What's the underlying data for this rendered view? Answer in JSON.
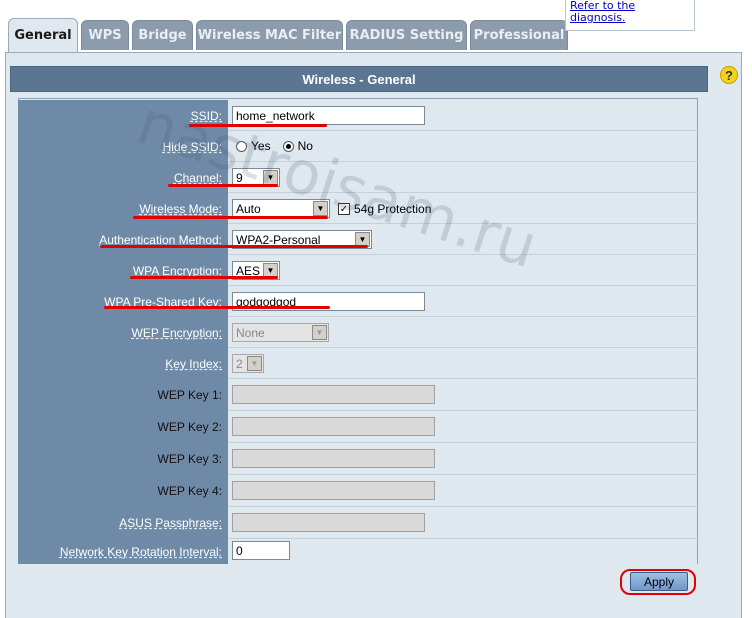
{
  "tabs": [
    {
      "label": "General",
      "active": true
    },
    {
      "label": "WPS",
      "active": false
    },
    {
      "label": "Bridge",
      "active": false
    },
    {
      "label": "Wireless MAC Filter",
      "active": false
    },
    {
      "label": "RADIUS Setting",
      "active": false
    },
    {
      "label": "Professional",
      "active": false
    }
  ],
  "diagnosis_link": {
    "line1": "Refer to the",
    "line2": "diagnosis."
  },
  "panel": {
    "title": "Wireless - General",
    "help_icon": "?"
  },
  "form": {
    "ssid": {
      "label": "SSID:",
      "value": "home_network"
    },
    "hide_ssid": {
      "label": "Hide SSID:",
      "options": [
        "Yes",
        "No"
      ],
      "selected": "No"
    },
    "channel": {
      "label": "Channel:",
      "value": "9"
    },
    "wireless_mode": {
      "label": "Wireless Mode:",
      "value": "Auto",
      "protection_label": "54g Protection",
      "protection_checked": true
    },
    "auth_method": {
      "label": "Authentication Method:",
      "value": "WPA2-Personal"
    },
    "wpa_encryption": {
      "label": "WPA Encryption:",
      "value": "AES"
    },
    "wpa_psk": {
      "label": "WPA Pre-Shared Key:",
      "value": "godgodgod"
    },
    "wep_encryption": {
      "label": "WEP Encryption:",
      "value": "None"
    },
    "key_index": {
      "label": "Key Index:",
      "value": "2"
    },
    "wep_key1": {
      "label": "WEP Key 1:",
      "value": ""
    },
    "wep_key2": {
      "label": "WEP Key 2:",
      "value": ""
    },
    "wep_key3": {
      "label": "WEP Key 3:",
      "value": ""
    },
    "wep_key4": {
      "label": "WEP Key 4:",
      "value": ""
    },
    "asus_passphrase": {
      "label": "ASUS Passphrase:",
      "value": ""
    },
    "key_rotation": {
      "label": "Network Key Rotation Interval:",
      "value": "0"
    }
  },
  "apply_label": "Apply",
  "watermark": "nastroisam.ru",
  "colors": {
    "header": "#5b7693",
    "label_bg": "#6f8aa6",
    "panel_bg": "#dfe8ef",
    "annotation": "#e00000"
  }
}
